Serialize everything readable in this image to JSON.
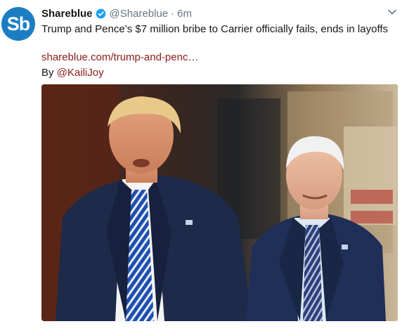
{
  "account": {
    "avatar_text": "Sb",
    "display_name": "Shareblue",
    "handle": "@Shareblue",
    "separator": "·",
    "time": "6m"
  },
  "tweet": {
    "text": "Trump and Pence’s $7 million bribe to Carrier officially fails, ends in layoffs",
    "link_text": "shareblue.com/trump-and-penc…",
    "byline_prefix": "By ",
    "byline_mention": "@KailiJoy"
  },
  "colors": {
    "avatar_bg": "#1b7ec2",
    "verified": "#1da1f2",
    "link": "#8b1a1a"
  },
  "icons": {
    "verified": "verified-badge-icon",
    "menu": "chevron-down-icon"
  }
}
